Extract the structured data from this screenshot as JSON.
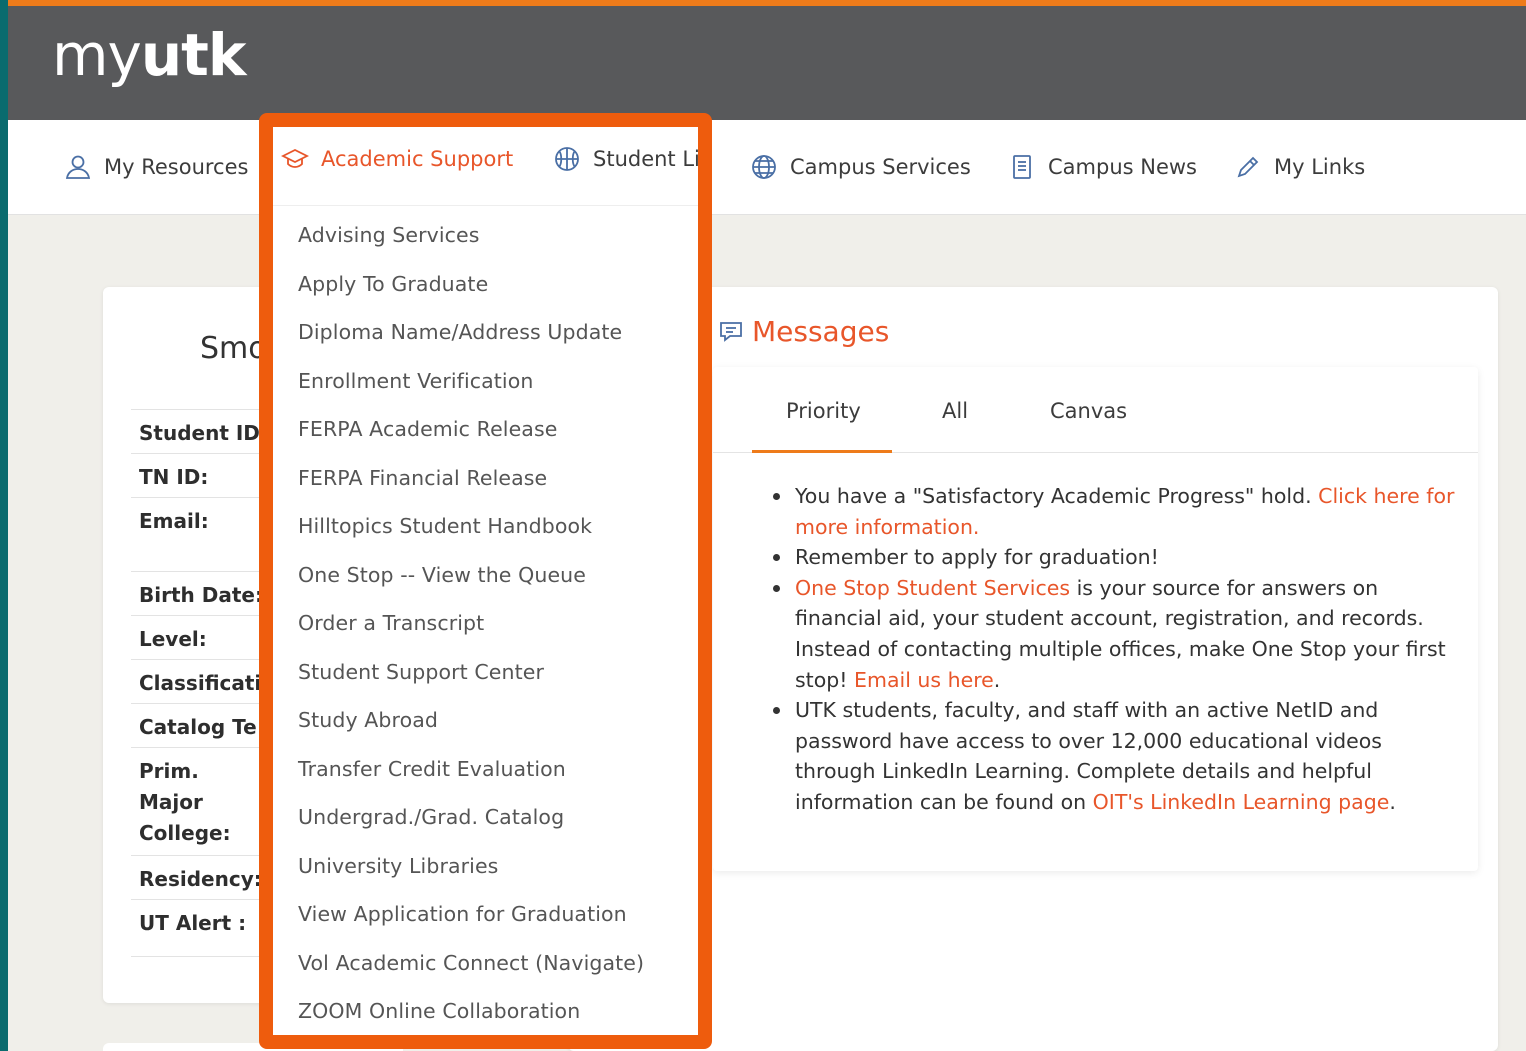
{
  "header": {
    "logo_thin": "my",
    "logo_bold": "utk"
  },
  "nav": {
    "items": [
      {
        "label": "My Resources",
        "icon": "user-icon"
      },
      {
        "label": "Academic Support",
        "icon": "graduation-cap-icon"
      },
      {
        "label": "Student Lif",
        "icon": "basketball-icon"
      },
      {
        "label": "Campus Services",
        "icon": "globe-icon"
      },
      {
        "label": "Campus News",
        "icon": "document-icon"
      },
      {
        "label": "My Links",
        "icon": "pencil-icon"
      }
    ]
  },
  "dropdown": {
    "items": [
      "Advising Services",
      "Apply To Graduate",
      "Diploma Name/Address Update",
      "Enrollment Verification",
      "FERPA Academic Release",
      "FERPA Financial Release",
      "Hilltopics Student Handbook",
      "One Stop -- View the Queue",
      "Order a Transcript",
      "Student Support Center",
      "Study Abroad",
      "Transfer Credit Evaluation",
      "Undergrad./Grad. Catalog",
      "University Libraries",
      "View Application for Graduation",
      "Vol Academic Connect (Navigate)",
      "ZOOM Online Collaboration"
    ]
  },
  "profile": {
    "name_fragment": "Smo",
    "rows": [
      "Student ID:",
      "TN ID:",
      "Email:",
      "Birth Date:",
      "Level:",
      "Classificati",
      "Catalog Te",
      "Prim. Major College:",
      "Residency:",
      "UT Alert :"
    ]
  },
  "messages": {
    "title": "Messages",
    "tabs": [
      "Priority",
      "All",
      "Canvas"
    ],
    "items": {
      "m1_text": "You have a \"Satisfactory Academic Progress\" hold. ",
      "m1_link": "Click here for more information.",
      "m2_text": "Remember to apply for graduation!",
      "m3_link1": "One Stop Student Services",
      "m3_text1": " is your source for answers on financial aid, your student account, registration, and records. Instead of contacting multiple offices, make One Stop your first stop!  ",
      "m3_link2": "Email us here",
      "m3_text2": ".",
      "m4_text": "UTK students, faculty, and staff with an active NetID and password have access to over 12,000 educational videos through LinkedIn Learning. Complete details and helpful information can be found on ",
      "m4_link": "OIT's LinkedIn Learning page",
      "m4_end": "."
    }
  },
  "colors": {
    "accent": "#e8562a",
    "highlight": "#ee5c0d",
    "topbar": "#58595b",
    "topstripe": "#ee7b1a"
  }
}
